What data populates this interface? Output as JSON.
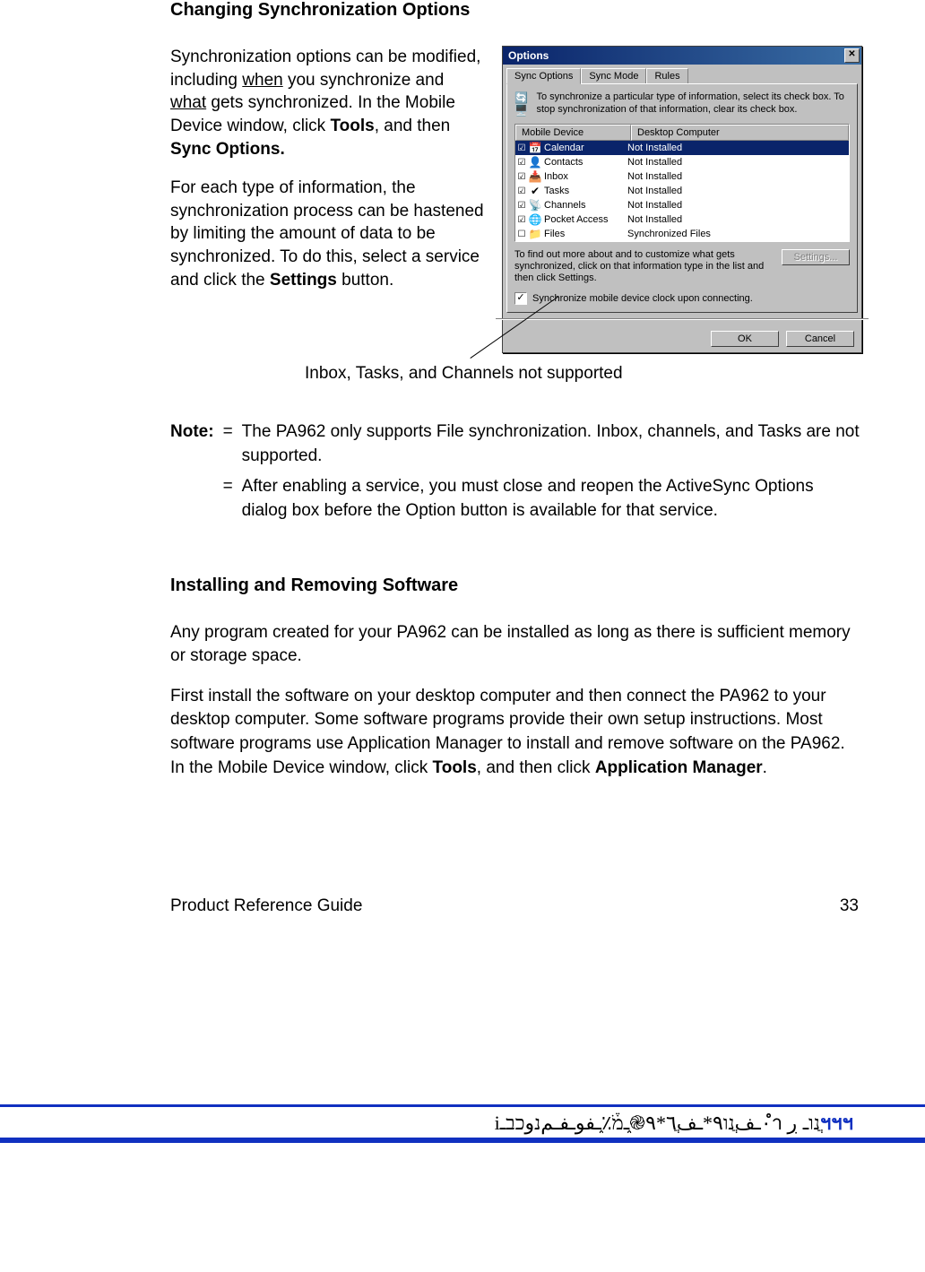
{
  "heading1": "Changing Synchronization Options",
  "intro": {
    "p1_a": "Synchronization options can be modified, including ",
    "p1_when": "when",
    "p1_b": " you synchronize and ",
    "p1_what": "what",
    "p1_c": " gets synchronized.  In the Mobile Device window, click ",
    "p1_tools": "Tools",
    "p1_d": ", and then ",
    "p1_sync": "Sync Options.",
    "p2_a": "For each type of information, the synchronization process can be hastened by limiting the amount of data to be synchronized.  To do this, select a service and click the ",
    "p2_settings": "Settings",
    "p2_b": " button."
  },
  "annotation": "Inbox, Tasks, and Channels not supported",
  "options": {
    "title": "Options",
    "close": "✕",
    "tabs": [
      "Sync Options",
      "Sync Mode",
      "Rules"
    ],
    "info": "To synchronize a particular type of information, select its check box. To stop synchronization of that information, clear its check box.",
    "headers": [
      "Mobile Device",
      "Desktop Computer"
    ],
    "rows": [
      {
        "icon": "📅",
        "label": "Calendar",
        "status": "Not Installed",
        "selected": true,
        "checked": true
      },
      {
        "icon": "👤",
        "label": "Contacts",
        "status": "Not Installed",
        "selected": false,
        "checked": true
      },
      {
        "icon": "📥",
        "label": "Inbox",
        "status": "Not Installed",
        "selected": false,
        "checked": true
      },
      {
        "icon": "✔",
        "label": "Tasks",
        "status": "Not Installed",
        "selected": false,
        "checked": true
      },
      {
        "icon": "📡",
        "label": "Channels",
        "status": "Not Installed",
        "selected": false,
        "checked": true
      },
      {
        "icon": "🌐",
        "label": "Pocket Access",
        "status": "Not Installed",
        "selected": false,
        "checked": true
      },
      {
        "icon": "📁",
        "label": "Files",
        "status": "Synchronized Files",
        "selected": false,
        "checked": false
      }
    ],
    "belowText": "To find out more about and to customize what gets synchronized, click on that information type in the list and then click Settings.",
    "settingsBtn": "Settings...",
    "clockChk": "Synchronize mobile device clock upon connecting.",
    "ok": "OK",
    "cancel": "Cancel"
  },
  "note": {
    "label": "Note:",
    "items": [
      "The PA962 only supports File synchronization.  Inbox, channels, and Tasks are not supported.",
      "After enabling a service, you must close and reopen the ActiveSync Options dialog box before the Option button is available for that service."
    ]
  },
  "heading2": "Installing and Removing Software",
  "body2a": "Any program created for your PA962 can be installed as long as there is sufficient memory or storage space.",
  "body2b_a": "First install the software on your desktop computer and then connect the PA962 to your desktop computer.  Some software programs provide their own setup instructions.  Most software programs use Application Manager to install and remove software on the PA962.  In the Mobile Device window, click ",
  "body2b_tools": "Tools",
  "body2b_b": ", and then click ",
  "body2b_appmgr": "Application Manager",
  "body2b_c": ".",
  "footer": {
    "left": "Product Reference Guide",
    "right": "33"
  },
  "garbled": "ֲנוـ ڔ ٠ำـفֲנו٩*ـفֲ٦*٩֎֑ـמֹ֒٪֑ـفوـفـمנوכבـi",
  "garbled_lead": "ฯฯฯ"
}
